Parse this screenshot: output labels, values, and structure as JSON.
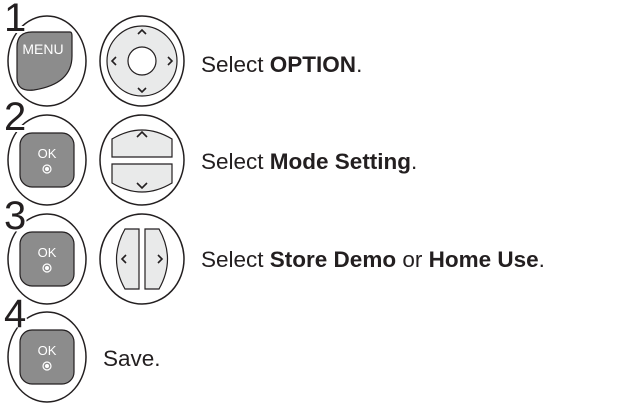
{
  "colors": {
    "button_fill": "#8c8c8c",
    "nav_fill": "#e9eaea",
    "outline": "#231f20",
    "text": "#231f20"
  },
  "steps": [
    {
      "number": "1",
      "keys": [
        "MENU",
        "nav-4way"
      ],
      "text_prefix": "Select ",
      "text_bold": "OPTION",
      "text_suffix": "."
    },
    {
      "number": "2",
      "keys": [
        "OK",
        "nav-updown"
      ],
      "text_prefix": "Select ",
      "text_bold": "Mode Setting",
      "text_suffix": "."
    },
    {
      "number": "3",
      "keys": [
        "OK",
        "nav-leftright"
      ],
      "text_prefix": "Select ",
      "text_bold": "Store Demo",
      "text_middle": " or ",
      "text_bold2": "Home Use",
      "text_suffix": "."
    },
    {
      "number": "4",
      "keys": [
        "OK"
      ],
      "text": "Save."
    }
  ],
  "labels": {
    "menu_key": "MENU",
    "ok_key": "OK",
    "up_arrow": "^",
    "down_arrow": "v",
    "left_arrow": "<",
    "right_arrow": ">"
  }
}
